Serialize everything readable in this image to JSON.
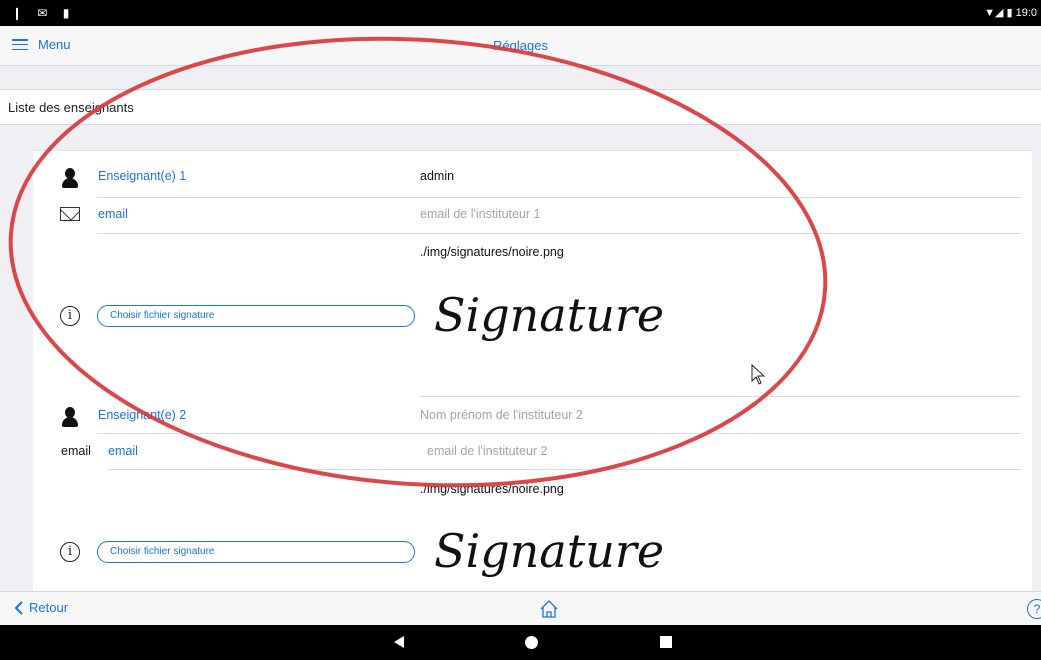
{
  "status_bar": {
    "left_icons": "❙ ✉ ▮",
    "time": "19:0"
  },
  "navbar": {
    "menu_label": "Menu",
    "title": "Réglages"
  },
  "section_header": "Liste des enseignants",
  "teachers": [
    {
      "label": "Enseignant(e) 1",
      "name_value": "admin",
      "email_label": "email",
      "email_placeholder": "email de l'instituteur 1",
      "signature_path": "./img/signatures/noire.png",
      "choose_button": "Choisir fichier signature",
      "signature_text": "Signature"
    },
    {
      "label": "Enseignant(e) 2",
      "name_placeholder": "Nom prénom de l'instituteur 2",
      "email_static": "email",
      "email_label": "email",
      "email_placeholder": "email de l'instituteur 2",
      "signature_path": "./img/signatures/noire.png",
      "choose_button": "Choisir fichier signature",
      "signature_text": "Signature"
    }
  ],
  "toolbar": {
    "back_label": "Retour",
    "help_label": "?"
  },
  "colors": {
    "accent": "#1a73e8",
    "annotation": "#d9383a"
  },
  "icons": [
    "menu-icon",
    "person-icon",
    "envelope-icon",
    "info-icon",
    "chevron-left-icon",
    "home-icon",
    "help-icon",
    "mouse-cursor-icon"
  ]
}
